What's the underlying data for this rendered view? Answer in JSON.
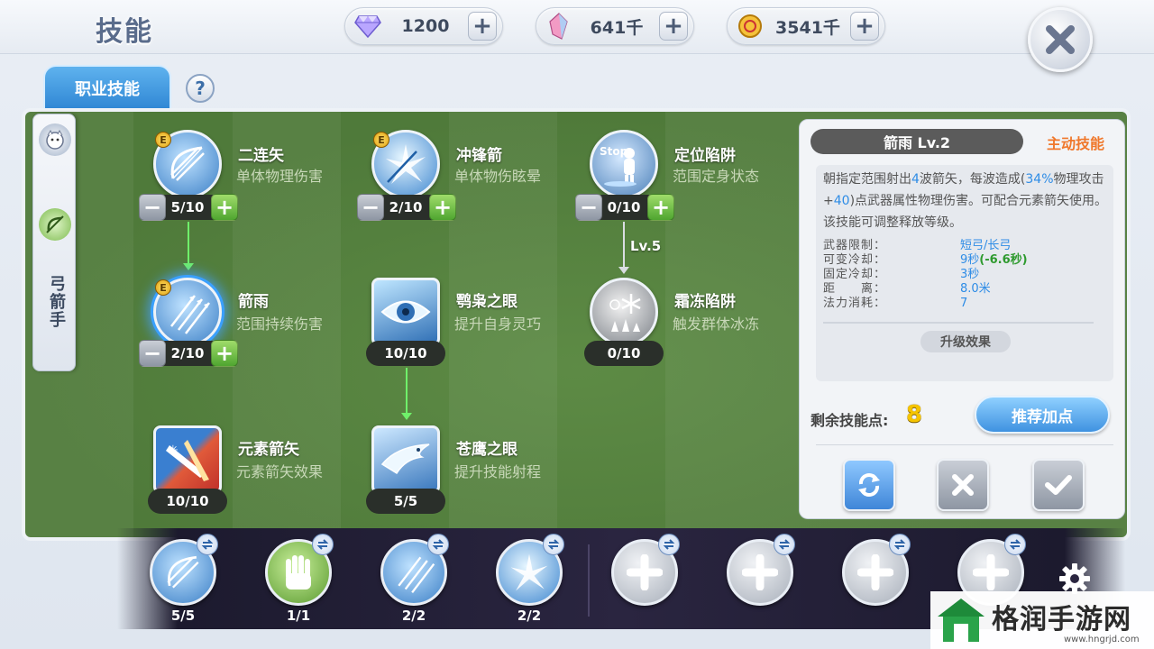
{
  "header": {
    "title": "技能",
    "currencies": [
      {
        "icon": "diamond-icon",
        "value": "1200"
      },
      {
        "icon": "crystal-shard-icon",
        "value": "641千"
      },
      {
        "icon": "gold-coin-icon",
        "value": "3541千"
      }
    ]
  },
  "tabs": {
    "active": "职业技能"
  },
  "help": "?",
  "class_side": {
    "label": "弓箭手"
  },
  "skills": [
    {
      "name": "二连矢",
      "desc": "单体物理伤害",
      "level": "5/10",
      "icon": "double-arrow-bow-icon",
      "badge": "E"
    },
    {
      "name": "冲锋箭",
      "desc": "单体物伤眩晕",
      "level": "2/10",
      "icon": "charge-arrow-icon",
      "badge": "E"
    },
    {
      "name": "定位陷阱",
      "desc": "范围定身状态",
      "level": "0/10",
      "icon": "stop-trap-icon",
      "icon_text": "Stop"
    },
    {
      "name": "箭雨",
      "desc": "范围持续伤害",
      "level": "2/10",
      "icon": "arrow-rain-icon",
      "badge": "E"
    },
    {
      "name": "鹗枭之眼",
      "desc": "提升自身灵巧",
      "level": "10/10",
      "icon": "owl-eye-icon"
    },
    {
      "name": "霜冻陷阱",
      "desc": "触发群体冰冻",
      "level": "0/10",
      "icon": "frost-trap-icon"
    },
    {
      "name": "元素箭矢",
      "desc": "元素箭矢效果",
      "level": "10/10",
      "icon": "element-arrow-icon"
    },
    {
      "name": "苍鹰之眼",
      "desc": "提升技能射程",
      "level": "5/5",
      "icon": "hawk-eye-icon"
    }
  ],
  "requirement": "Lv.5",
  "detail": {
    "title": "箭雨 Lv.2",
    "type": "主动技能",
    "desc_parts": [
      "朝指定范围射出",
      "4",
      "波箭矢，每波造成(",
      "34%",
      "物理攻击+",
      "40",
      ")点武器属性物理伤害。可配合元素箭矢使用。该技能可调整释放等级。"
    ],
    "stats": [
      {
        "key": "武器限制：",
        "value": "短弓/长弓"
      },
      {
        "key": "可变冷却：",
        "value": "9秒",
        "extra": "(-6.6秒)"
      },
      {
        "key": "固定冷却：",
        "value": "3秒"
      },
      {
        "key": "距　　离：",
        "value": "8.0米"
      },
      {
        "key": "法力消耗：",
        "value": "7"
      }
    ],
    "upgrade_label": "升级效果",
    "remain_label": "剩余技能点:",
    "remain_value": "8",
    "recommend_label": "推荐加点"
  },
  "hotbar": {
    "slots": [
      {
        "icon": "double-arrow-bow-icon",
        "count": "5/5"
      },
      {
        "icon": "fist-icon",
        "count": "1/1"
      },
      {
        "icon": "arrow-rain-icon",
        "count": "2/2"
      },
      {
        "icon": "charge-arrow-icon",
        "count": "2/2"
      },
      {
        "icon": "plus-icon",
        "count": ""
      },
      {
        "icon": "plus-icon",
        "count": ""
      },
      {
        "icon": "plus-icon",
        "count": ""
      },
      {
        "icon": "plus-icon",
        "count": ""
      }
    ]
  },
  "watermark": {
    "text": "格润手游网",
    "url": "www.hngrjd.com"
  },
  "colors": {
    "panel_green": "#4f7a3a",
    "accent_blue": "#3f92e0",
    "skill_type_orange": "#f0782c",
    "points_yellow": "#f5c400"
  }
}
